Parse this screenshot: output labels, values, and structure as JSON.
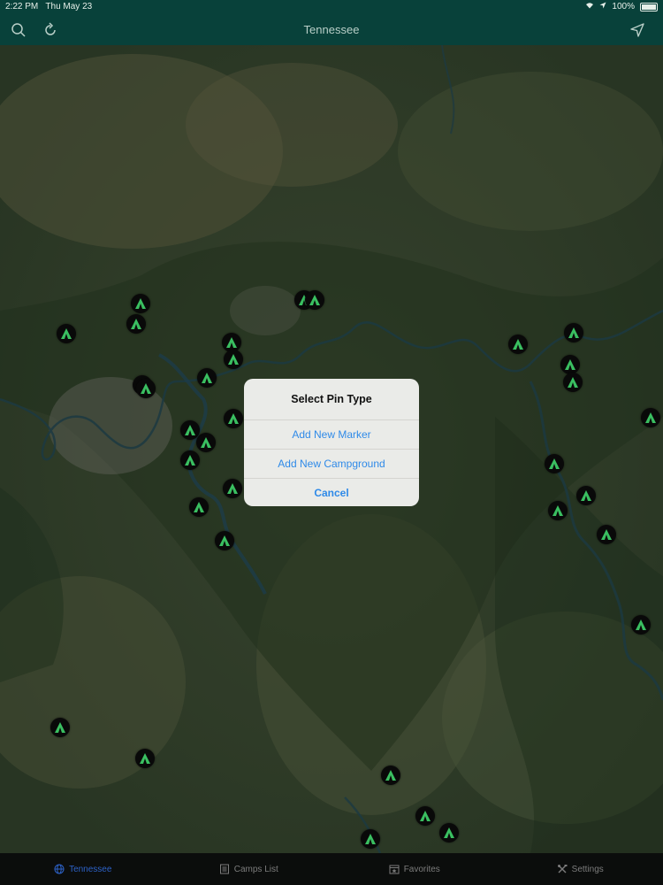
{
  "status_bar": {
    "time": "2:22 PM",
    "date": "Thu May 23",
    "battery": "100%"
  },
  "nav": {
    "title": "Tennessee",
    "search_icon": "search-icon",
    "refresh_icon": "refresh-icon",
    "locate_icon": "location-arrow-icon"
  },
  "map": {
    "type": "satellite",
    "pin_icon": "tent-icon",
    "pin_color": "#3fd06a",
    "pin_count": 38
  },
  "alert": {
    "title": "Select Pin Type",
    "actions": [
      "Add New Marker",
      "Add New Campground"
    ],
    "cancel_label": "Cancel",
    "action_color": "#2f8ae8"
  },
  "tabs": [
    {
      "label": "Tennessee",
      "icon": "globe-icon",
      "active": true
    },
    {
      "label": "Camps List",
      "icon": "list-icon",
      "active": false
    },
    {
      "label": "Favorites",
      "icon": "calendar-star-icon",
      "active": false
    },
    {
      "label": "Settings",
      "icon": "tools-icon",
      "active": false
    }
  ],
  "colors": {
    "header": "#08413a",
    "tab_active": "#2d62c8",
    "tab_bar": "#0b0d0c"
  }
}
